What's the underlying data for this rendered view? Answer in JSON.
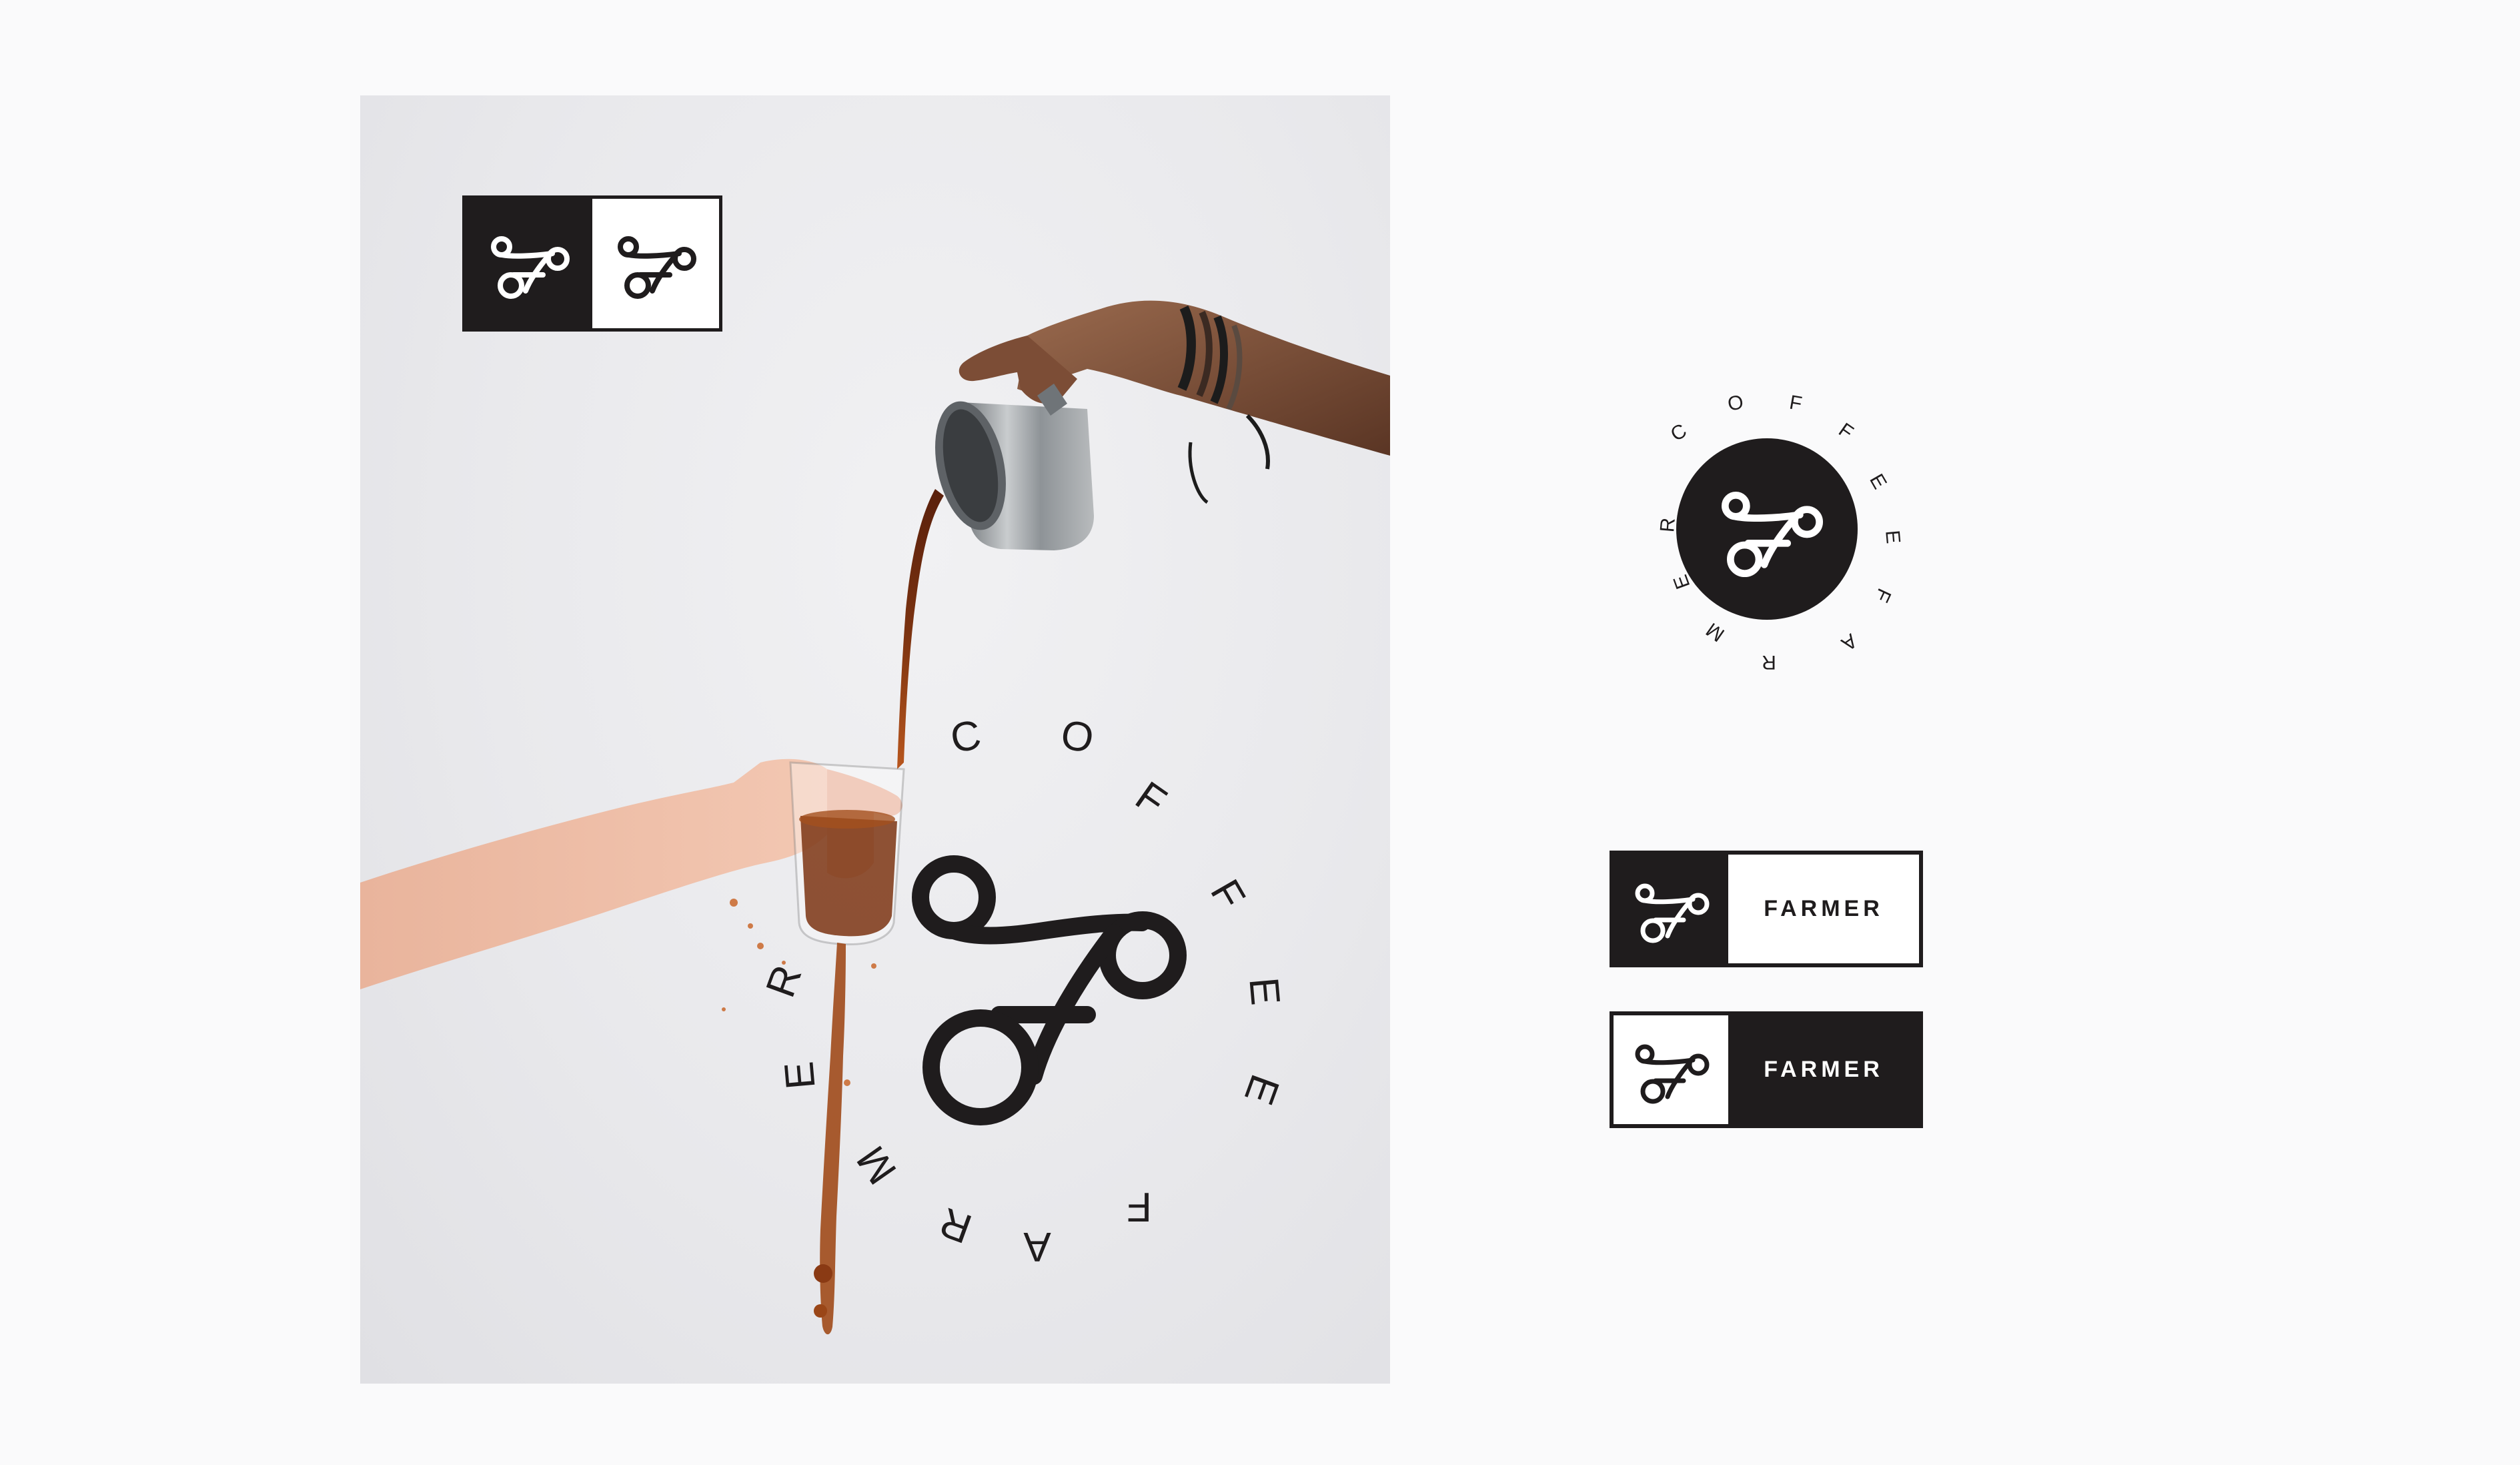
{
  "brand": {
    "ring_text": [
      "C",
      "O",
      "F",
      "F",
      "E",
      "E",
      "F",
      "A",
      "R",
      "M",
      "E",
      "R"
    ],
    "wordmark": "FARMER",
    "logo_icon": "fo-monogram-icon"
  },
  "colors": {
    "ink": "#1f1c1d",
    "paper": "#ffffff",
    "background": "#fafafb",
    "coffee": "#6b2c14"
  }
}
